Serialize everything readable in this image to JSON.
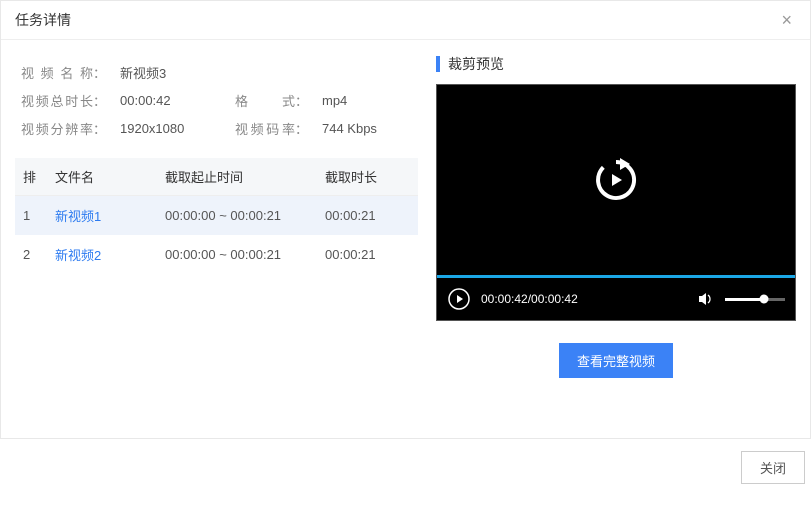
{
  "header": {
    "title": "任务详情"
  },
  "info": {
    "labels": {
      "name": "视频名称",
      "duration": "视频总时长",
      "format": "格式",
      "resolution": "视频分辨率",
      "bitrate": "视频码率"
    },
    "name": "新视频3",
    "duration": "00:00:42",
    "format": "mp4",
    "resolution": "1920x1080",
    "bitrate": "744 Kbps"
  },
  "table": {
    "headers": {
      "index": "排",
      "filename": "文件名",
      "range": "截取起止时间",
      "dur": "截取时长"
    },
    "rows": [
      {
        "index": "1",
        "filename": "新视频1",
        "range": "00:00:00 ~ 00:00:21",
        "dur": "00:00:21",
        "selected": true
      },
      {
        "index": "2",
        "filename": "新视频2",
        "range": "00:00:00 ~ 00:00:21",
        "dur": "00:00:21",
        "selected": false
      }
    ]
  },
  "preview": {
    "title": "裁剪预览",
    "time_display": "00:00:42/00:00:42",
    "view_button": "查看完整视频"
  },
  "footer": {
    "close": "关闭"
  }
}
